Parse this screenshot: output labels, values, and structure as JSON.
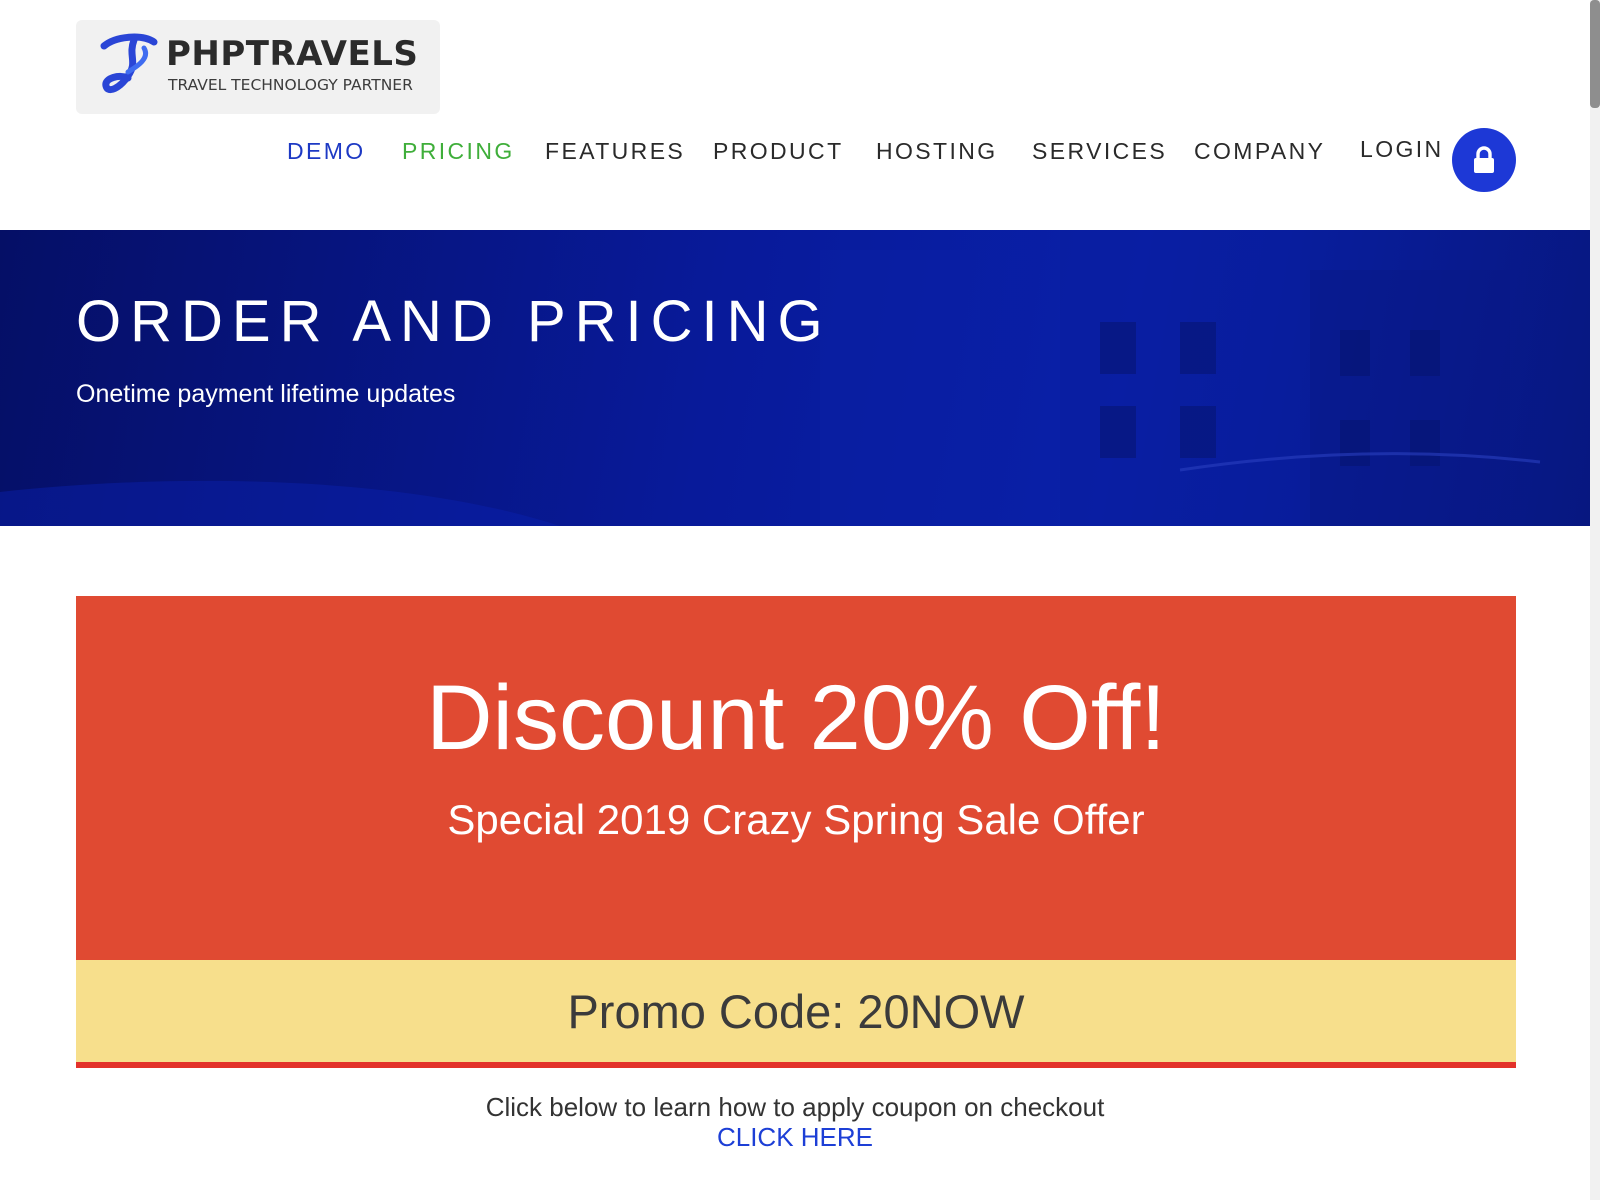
{
  "brand": {
    "name": "PHPTRAVELS",
    "tagline": "TRAVEL TECHNOLOGY PARTNER"
  },
  "nav": {
    "items": [
      {
        "label": "DEMO",
        "color": "#1d39c4"
      },
      {
        "label": "PRICING",
        "color": "#3fae3a"
      },
      {
        "label": "FEATURES",
        "color": "#2a2a2a"
      },
      {
        "label": "PRODUCT",
        "color": "#2a2a2a"
      },
      {
        "label": "HOSTING",
        "color": "#2a2a2a"
      },
      {
        "label": "SERVICES",
        "color": "#2a2a2a"
      },
      {
        "label": "COMPANY",
        "color": "#2a2a2a"
      },
      {
        "label": "LOGIN",
        "color": "#2a2a2a"
      }
    ],
    "login_icon": "lock-icon"
  },
  "hero": {
    "title": "ORDER AND PRICING",
    "subtitle": "Onetime payment lifetime updates"
  },
  "promo": {
    "headline": "Discount 20% Off!",
    "subheadline": "Special 2019 Crazy Spring Sale Offer",
    "code_label": "Promo Code: 20NOW",
    "note": "Click below to learn how to apply coupon on checkout",
    "link_label": "CLICK HERE"
  },
  "colors": {
    "accent_blue": "#1d38d6",
    "hero_blue": "#081a9a",
    "discount_red": "#e04a32",
    "promo_yellow": "#f7df8c",
    "pricing_green": "#3fae3a"
  }
}
